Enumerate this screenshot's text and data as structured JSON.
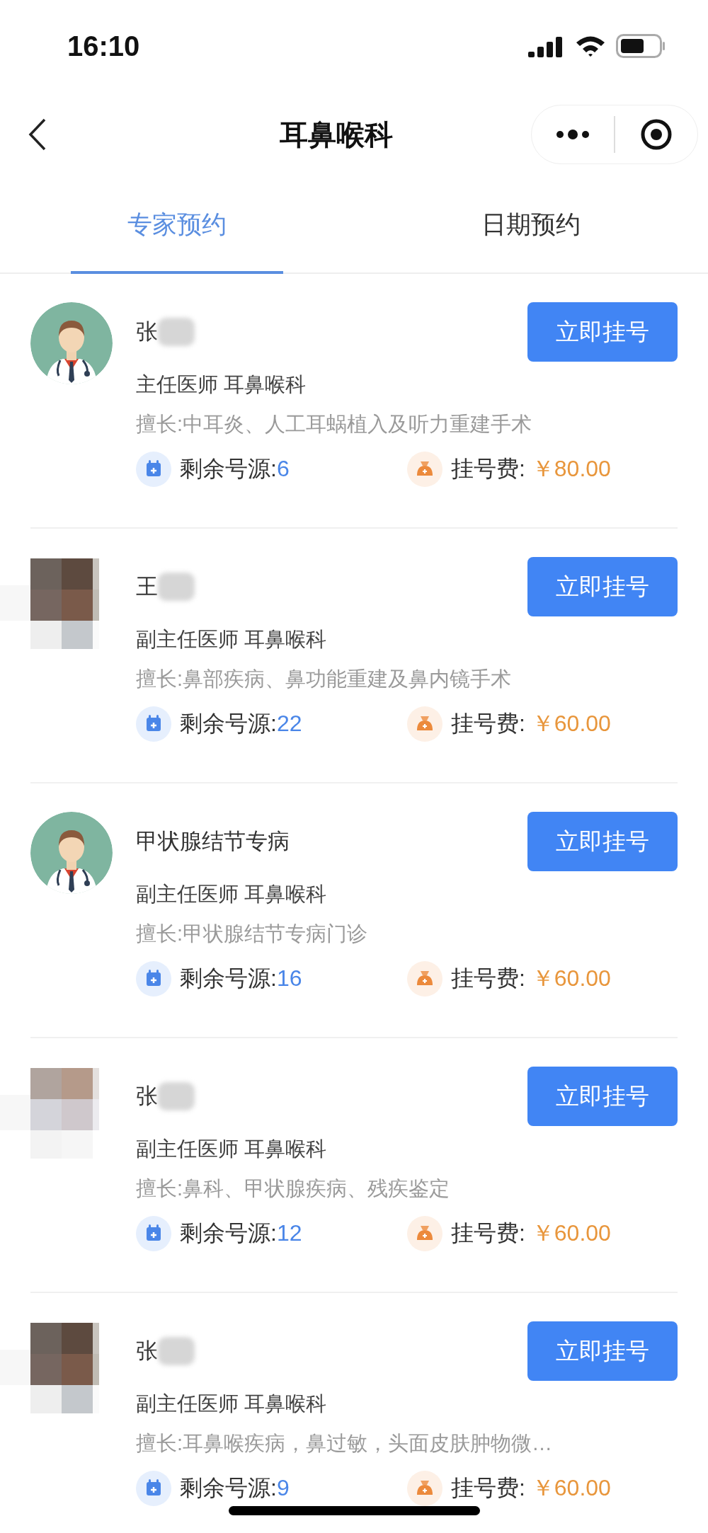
{
  "status_bar": {
    "time": "16:10"
  },
  "nav": {
    "title": "耳鼻喉科"
  },
  "tabs": [
    {
      "label": "专家预约",
      "selected": true
    },
    {
      "label": "日期预约",
      "selected": false
    }
  ],
  "doctors": [
    {
      "avatar": {
        "kind": "doctor"
      },
      "name": "张",
      "redacted": true,
      "title": "主任医师 耳鼻喉科",
      "specialty": "擅长:中耳炎、人工耳蜗植入及听力重建手术",
      "remaining_label": "剩余号源:",
      "remaining": "6",
      "fee_label": "挂号费:",
      "fee": "￥80.00",
      "button": "立即挂号"
    },
    {
      "name": "王",
      "redacted": true,
      "title": "副主任医师 耳鼻喉科",
      "specialty": "擅长:鼻部疾病、鼻功能重建及鼻内镜手术",
      "remaining_label": "剩余号源:",
      "remaining": "22",
      "fee_label": "挂号费:",
      "fee": "￥60.00",
      "button": "立即挂号"
    },
    {
      "avatar": {
        "kind": "doctor"
      },
      "name": "甲状腺结节专病",
      "redacted": false,
      "title": "副主任医师 耳鼻喉科",
      "specialty": "擅长:甲状腺结节专病门诊",
      "remaining_label": "剩余号源:",
      "remaining": "16",
      "fee_label": "挂号费:",
      "fee": "￥60.00",
      "button": "立即挂号"
    },
    {
      "name": "张",
      "redacted": true,
      "title": "副主任医师 耳鼻喉科",
      "specialty": "擅长:鼻科、甲状腺疾病、残疾鉴定",
      "remaining_label": "剩余号源:",
      "remaining": "12",
      "fee_label": "挂号费:",
      "fee": "￥60.00",
      "button": "立即挂号"
    },
    {
      "name": "张",
      "redacted": true,
      "title": "副主任医师 耳鼻喉科",
      "specialty": "擅长:耳鼻喉疾病，鼻过敏，头面皮肤肿物微…",
      "remaining_label": "剩余号源:",
      "remaining": "9",
      "fee_label": "挂号费:",
      "fee": "￥60.00",
      "button": "立即挂号"
    }
  ]
}
